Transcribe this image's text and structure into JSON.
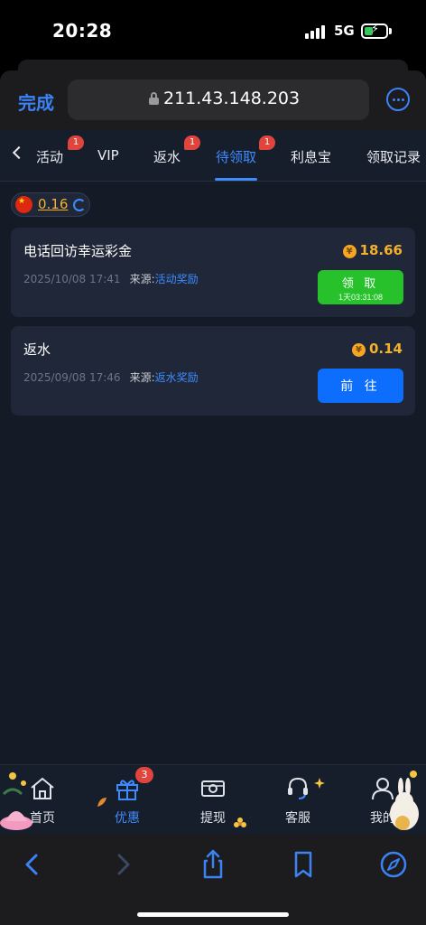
{
  "status_bar": {
    "time": "20:28",
    "network": "5G"
  },
  "browser": {
    "done_label": "完成",
    "url": "211.43.148.203"
  },
  "tabs": [
    {
      "label": "活动",
      "badge": "1"
    },
    {
      "label": "VIP",
      "badge": ""
    },
    {
      "label": "返水",
      "badge": "1"
    },
    {
      "label": "待领取",
      "badge": "1",
      "active": true
    },
    {
      "label": "利息宝",
      "badge": ""
    },
    {
      "label": "领取记录",
      "badge": ""
    }
  ],
  "balance": {
    "amount": "0.16"
  },
  "rewards": [
    {
      "title": "电话回访幸运彩金",
      "time": "2025/10/08 17:41",
      "source_label": "来源:",
      "source": "活动奖励",
      "amount": "18.66",
      "action": "领 取",
      "countdown": "1天03:31:08"
    },
    {
      "title": "返水",
      "time": "2025/09/08 17:46",
      "source_label": "来源:",
      "source": "返水奖励",
      "amount": "0.14",
      "action": "前 往"
    }
  ],
  "bottom_nav": [
    {
      "label": "首页",
      "icon": "home-icon"
    },
    {
      "label": "优惠",
      "icon": "gift-icon",
      "badge": "3",
      "active": true
    },
    {
      "label": "提现",
      "icon": "withdraw-icon"
    },
    {
      "label": "客服",
      "icon": "headset-icon"
    },
    {
      "label": "我的",
      "icon": "user-icon"
    }
  ],
  "coin_symbol": "¥",
  "colors": {
    "accent": "#3d8bff",
    "gold": "#f5b12a",
    "claim_green": "#26c12b",
    "badge_red": "#e0443c",
    "page_bg": "#141a26"
  }
}
